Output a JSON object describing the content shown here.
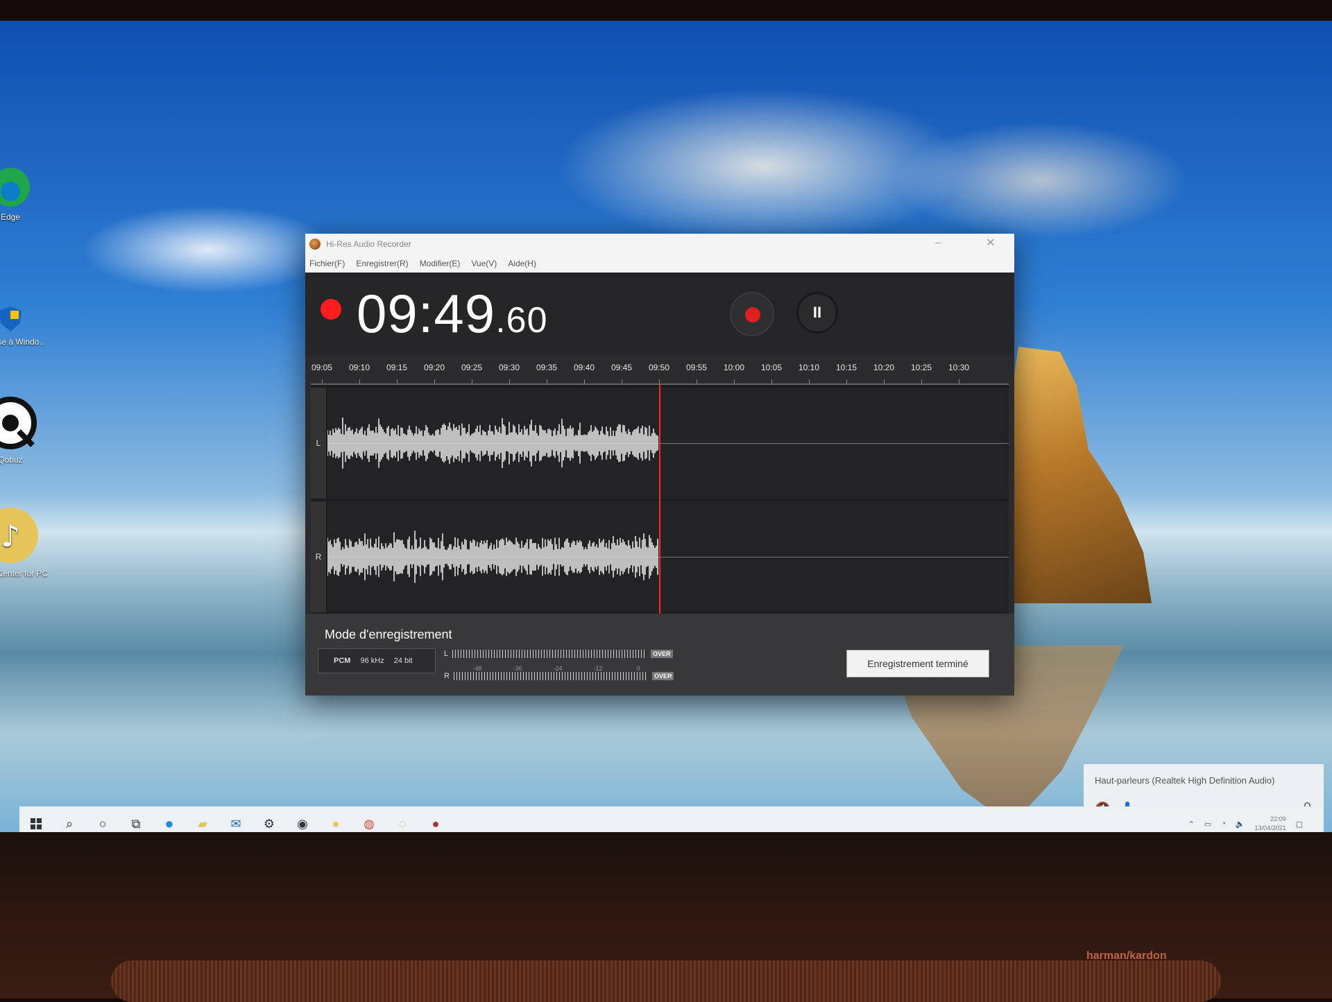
{
  "desktop": {
    "icons": [
      {
        "label": "Edge",
        "icon": "edge-icon"
      },
      {
        "label": "...e Mise à Windo...",
        "icon": "shield-icon"
      },
      {
        "label": "Qobuz",
        "icon": "qobuz-icon"
      },
      {
        "label": "Music Center for PC",
        "icon": "music-note-icon"
      }
    ]
  },
  "window": {
    "title": "Hi-Res Audio Recorder",
    "menu": [
      "Fichier(F)",
      "Enregistrer(R)",
      "Modifier(E)",
      "Vue(V)",
      "Aide(H)"
    ],
    "minimize_glyph": "–",
    "close_glyph": "✕"
  },
  "recorder": {
    "time_main": "09:49",
    "time_frac": ".60",
    "timeline_labels": [
      "09:05",
      "09:10",
      "09:15",
      "09:20",
      "09:25",
      "09:30",
      "09:35",
      "09:40",
      "09:45",
      "09:50",
      "09:55",
      "10:00",
      "10:05",
      "10:10",
      "10:15",
      "10:20",
      "10:25",
      "10:30"
    ],
    "channels": {
      "left": "L",
      "right": "R"
    },
    "recorded_fraction": 0.49,
    "mode_title": "Mode d'enregistrement",
    "format": {
      "codec": "PCM",
      "rate": "96 kHz",
      "depth": "24 bit"
    },
    "meter_labels": {
      "left": "L",
      "right": "R",
      "over": "OVER"
    },
    "db_scale": [
      "-48",
      "-36",
      "-24",
      "-12",
      "0"
    ],
    "finish_button": "Enregistrement terminé",
    "pause_glyph": "II"
  },
  "volume_flyout": {
    "device": "Haut-parleurs (Realtek High Definition Audio)",
    "value": "0",
    "muted_icon": "speaker-muted-icon"
  },
  "taskbar": {
    "icons": [
      "windows-start-icon",
      "search-icon",
      "cortana-icon",
      "task-view-icon",
      "edge-icon",
      "file-explorer-icon",
      "mail-icon",
      "settings-icon",
      "qobuz-icon",
      "music-center-icon",
      "chrome-icon",
      "app-icon",
      "hi-res-recorder-icon"
    ],
    "clock_time": "22:09",
    "clock_date": "13/04/2021"
  },
  "bezel": {
    "brand": "harman/kardon"
  }
}
